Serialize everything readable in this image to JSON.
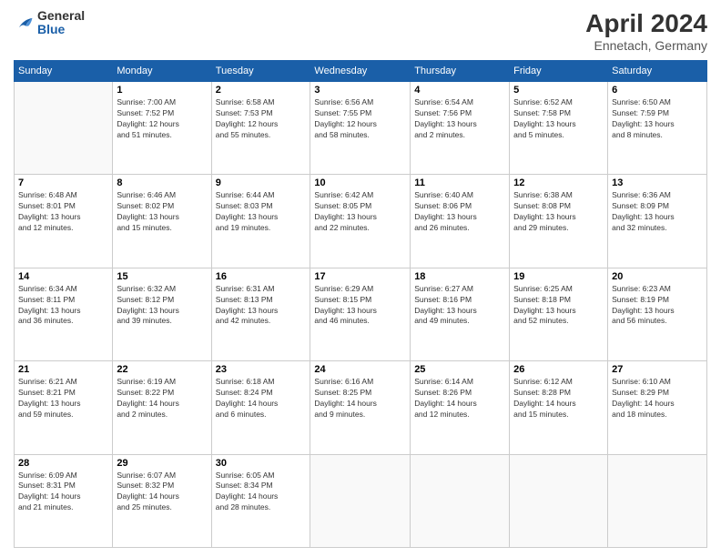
{
  "header": {
    "logo_general": "General",
    "logo_blue": "Blue",
    "month_title": "April 2024",
    "location": "Ennetach, Germany"
  },
  "days_of_week": [
    "Sunday",
    "Monday",
    "Tuesday",
    "Wednesday",
    "Thursday",
    "Friday",
    "Saturday"
  ],
  "weeks": [
    [
      {
        "day": "",
        "info": ""
      },
      {
        "day": "1",
        "info": "Sunrise: 7:00 AM\nSunset: 7:52 PM\nDaylight: 12 hours\nand 51 minutes."
      },
      {
        "day": "2",
        "info": "Sunrise: 6:58 AM\nSunset: 7:53 PM\nDaylight: 12 hours\nand 55 minutes."
      },
      {
        "day": "3",
        "info": "Sunrise: 6:56 AM\nSunset: 7:55 PM\nDaylight: 12 hours\nand 58 minutes."
      },
      {
        "day": "4",
        "info": "Sunrise: 6:54 AM\nSunset: 7:56 PM\nDaylight: 13 hours\nand 2 minutes."
      },
      {
        "day": "5",
        "info": "Sunrise: 6:52 AM\nSunset: 7:58 PM\nDaylight: 13 hours\nand 5 minutes."
      },
      {
        "day": "6",
        "info": "Sunrise: 6:50 AM\nSunset: 7:59 PM\nDaylight: 13 hours\nand 8 minutes."
      }
    ],
    [
      {
        "day": "7",
        "info": "Sunrise: 6:48 AM\nSunset: 8:01 PM\nDaylight: 13 hours\nand 12 minutes."
      },
      {
        "day": "8",
        "info": "Sunrise: 6:46 AM\nSunset: 8:02 PM\nDaylight: 13 hours\nand 15 minutes."
      },
      {
        "day": "9",
        "info": "Sunrise: 6:44 AM\nSunset: 8:03 PM\nDaylight: 13 hours\nand 19 minutes."
      },
      {
        "day": "10",
        "info": "Sunrise: 6:42 AM\nSunset: 8:05 PM\nDaylight: 13 hours\nand 22 minutes."
      },
      {
        "day": "11",
        "info": "Sunrise: 6:40 AM\nSunset: 8:06 PM\nDaylight: 13 hours\nand 26 minutes."
      },
      {
        "day": "12",
        "info": "Sunrise: 6:38 AM\nSunset: 8:08 PM\nDaylight: 13 hours\nand 29 minutes."
      },
      {
        "day": "13",
        "info": "Sunrise: 6:36 AM\nSunset: 8:09 PM\nDaylight: 13 hours\nand 32 minutes."
      }
    ],
    [
      {
        "day": "14",
        "info": "Sunrise: 6:34 AM\nSunset: 8:11 PM\nDaylight: 13 hours\nand 36 minutes."
      },
      {
        "day": "15",
        "info": "Sunrise: 6:32 AM\nSunset: 8:12 PM\nDaylight: 13 hours\nand 39 minutes."
      },
      {
        "day": "16",
        "info": "Sunrise: 6:31 AM\nSunset: 8:13 PM\nDaylight: 13 hours\nand 42 minutes."
      },
      {
        "day": "17",
        "info": "Sunrise: 6:29 AM\nSunset: 8:15 PM\nDaylight: 13 hours\nand 46 minutes."
      },
      {
        "day": "18",
        "info": "Sunrise: 6:27 AM\nSunset: 8:16 PM\nDaylight: 13 hours\nand 49 minutes."
      },
      {
        "day": "19",
        "info": "Sunrise: 6:25 AM\nSunset: 8:18 PM\nDaylight: 13 hours\nand 52 minutes."
      },
      {
        "day": "20",
        "info": "Sunrise: 6:23 AM\nSunset: 8:19 PM\nDaylight: 13 hours\nand 56 minutes."
      }
    ],
    [
      {
        "day": "21",
        "info": "Sunrise: 6:21 AM\nSunset: 8:21 PM\nDaylight: 13 hours\nand 59 minutes."
      },
      {
        "day": "22",
        "info": "Sunrise: 6:19 AM\nSunset: 8:22 PM\nDaylight: 14 hours\nand 2 minutes."
      },
      {
        "day": "23",
        "info": "Sunrise: 6:18 AM\nSunset: 8:24 PM\nDaylight: 14 hours\nand 6 minutes."
      },
      {
        "day": "24",
        "info": "Sunrise: 6:16 AM\nSunset: 8:25 PM\nDaylight: 14 hours\nand 9 minutes."
      },
      {
        "day": "25",
        "info": "Sunrise: 6:14 AM\nSunset: 8:26 PM\nDaylight: 14 hours\nand 12 minutes."
      },
      {
        "day": "26",
        "info": "Sunrise: 6:12 AM\nSunset: 8:28 PM\nDaylight: 14 hours\nand 15 minutes."
      },
      {
        "day": "27",
        "info": "Sunrise: 6:10 AM\nSunset: 8:29 PM\nDaylight: 14 hours\nand 18 minutes."
      }
    ],
    [
      {
        "day": "28",
        "info": "Sunrise: 6:09 AM\nSunset: 8:31 PM\nDaylight: 14 hours\nand 21 minutes."
      },
      {
        "day": "29",
        "info": "Sunrise: 6:07 AM\nSunset: 8:32 PM\nDaylight: 14 hours\nand 25 minutes."
      },
      {
        "day": "30",
        "info": "Sunrise: 6:05 AM\nSunset: 8:34 PM\nDaylight: 14 hours\nand 28 minutes."
      },
      {
        "day": "",
        "info": ""
      },
      {
        "day": "",
        "info": ""
      },
      {
        "day": "",
        "info": ""
      },
      {
        "day": "",
        "info": ""
      }
    ]
  ]
}
